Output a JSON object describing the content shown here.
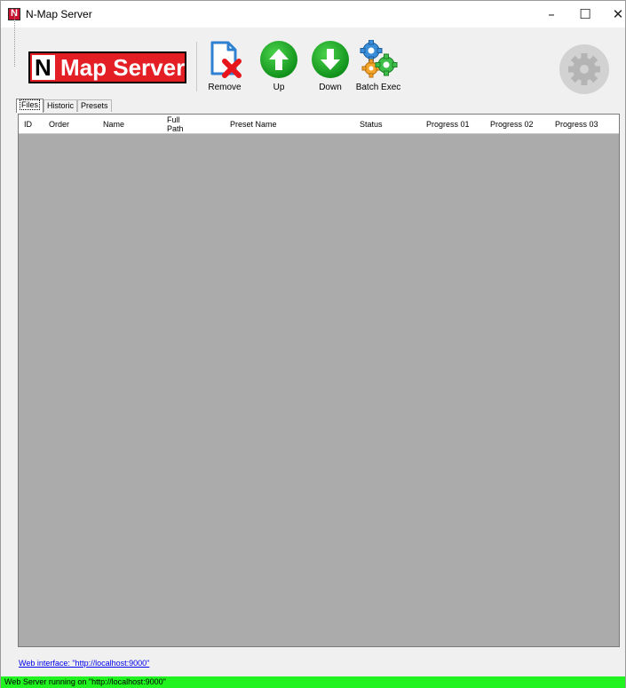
{
  "window": {
    "title": "N-Map Server",
    "minimize_glyph": "–",
    "maximize_glyph": "☐",
    "close_glyph": "✕"
  },
  "logo": {
    "letter": "N",
    "text": "Map Server",
    "colors": {
      "background": "#e31e24",
      "text": "#ffffff"
    }
  },
  "toolbar": {
    "remove_label": "Remove",
    "up_label": "Up",
    "down_label": "Down",
    "batch_label": "Batch Exec",
    "icons": {
      "remove": "document-delete-icon",
      "up": "arrow-up-circle-icon",
      "down": "arrow-down-circle-icon",
      "batch": "gears-icon",
      "settings": "gear-icon"
    }
  },
  "tabs": [
    {
      "label": "Files",
      "active": true
    },
    {
      "label": "Historic",
      "active": false
    },
    {
      "label": "Presets",
      "active": false
    }
  ],
  "table": {
    "columns": {
      "id": "ID",
      "order": "Order",
      "name": "Name",
      "path_line1": "Full",
      "path_line2": "Path",
      "preset": "Preset Name",
      "status": "Status",
      "progress1": "Progress 01",
      "progress2": "Progress 02",
      "progress3": "Progress 03"
    },
    "rows": [],
    "empty_color": "#ababab"
  },
  "footer": {
    "web_link": "Web interface: \"http://localhost:9000\"",
    "status": "Web Server running on \"http://localhost:9000\"",
    "status_color": "#21f321"
  }
}
